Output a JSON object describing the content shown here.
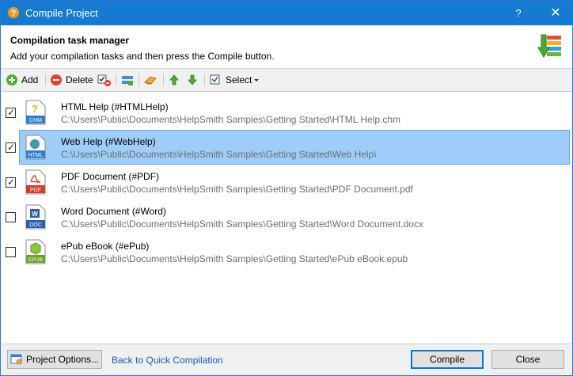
{
  "window": {
    "title": "Compile Project",
    "help_glyph": "?",
    "close_glyph": "✕"
  },
  "header": {
    "title": "Compilation task manager",
    "subtitle": "Add your compilation tasks and then press the Compile button."
  },
  "toolbar": {
    "add_label": "Add",
    "delete_label": "Delete",
    "select_label": "Select"
  },
  "tasks": [
    {
      "name": "HTML Help (#HTMLHelp)",
      "path": "C:\\Users\\Public\\Documents\\HelpSmith Samples\\Getting Started\\HTML Help.chm",
      "checked": true,
      "badge": "CHM",
      "icon": "chm-file-icon",
      "selected": false
    },
    {
      "name": "Web Help (#WebHelp)",
      "path": "C:\\Users\\Public\\Documents\\HelpSmith Samples\\Getting Started\\Web Help\\",
      "checked": true,
      "badge": "HTML",
      "icon": "html-file-icon",
      "selected": true
    },
    {
      "name": "PDF Document (#PDF)",
      "path": "C:\\Users\\Public\\Documents\\HelpSmith Samples\\Getting Started\\PDF Document.pdf",
      "checked": true,
      "badge": "PDF",
      "icon": "pdf-file-icon",
      "selected": false
    },
    {
      "name": "Word Document (#Word)",
      "path": "C:\\Users\\Public\\Documents\\HelpSmith Samples\\Getting Started\\Word Document.docx",
      "checked": false,
      "badge": "DOC",
      "icon": "doc-file-icon",
      "selected": false
    },
    {
      "name": "ePub eBook (#ePub)",
      "path": "C:\\Users\\Public\\Documents\\HelpSmith Samples\\Getting Started\\ePub eBook.epub",
      "checked": false,
      "badge": "EPUB",
      "icon": "epub-file-icon",
      "selected": false
    }
  ],
  "footer": {
    "project_options_label": "Project Options...",
    "quick_compilation_link": "Back to Quick Compilation",
    "compile_label": "Compile",
    "close_label": "Close"
  },
  "colors": {
    "titlebar": "#1679d2",
    "selection": "#9ecdf9",
    "link": "#1a58b6"
  }
}
